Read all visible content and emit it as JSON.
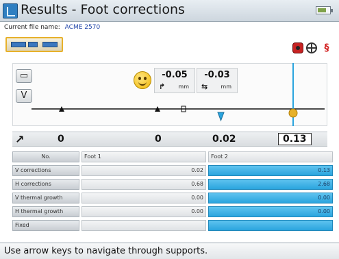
{
  "window": {
    "title": "Results - Foot corrections"
  },
  "file": {
    "label": "Current file name:",
    "name": "ACME 2570"
  },
  "coupling": {
    "vertical": {
      "value": "-0.05",
      "unit": "mm"
    },
    "horizontal": {
      "value": "-0.03",
      "unit": "mm"
    }
  },
  "view_buttons": {
    "v_label": "V"
  },
  "feet_values": [
    "0",
    "0",
    "0.02",
    "0.13"
  ],
  "table": {
    "headers": [
      "No.",
      "Foot 1",
      "Foot 2"
    ],
    "rows": [
      {
        "label": "V corrections",
        "foot1": "0.02",
        "foot2": "0.13"
      },
      {
        "label": "H corrections",
        "foot1": "0.68",
        "foot2": "2.68"
      },
      {
        "label": "V thermal growth",
        "foot1": "0.00",
        "foot2": "0.00"
      },
      {
        "label": "H thermal growth",
        "foot1": "0.00",
        "foot2": "0.00"
      },
      {
        "label": "Fixed",
        "foot1": "",
        "foot2": ""
      }
    ]
  },
  "status": {
    "message": "Use arrow keys to navigate through supports."
  },
  "icons": {
    "app": "app-icon",
    "battery": "battery-icon",
    "camera": "sensor-icon",
    "target": "target-icon",
    "thermal": "thermal-icon",
    "smiley": "smiley-icon",
    "view": "machine-view-icon",
    "row": "correction-arrow-icon"
  },
  "colors": {
    "accent": "#2aa4de",
    "selected": "#e7b12b",
    "status_ok": "#f2b705"
  }
}
